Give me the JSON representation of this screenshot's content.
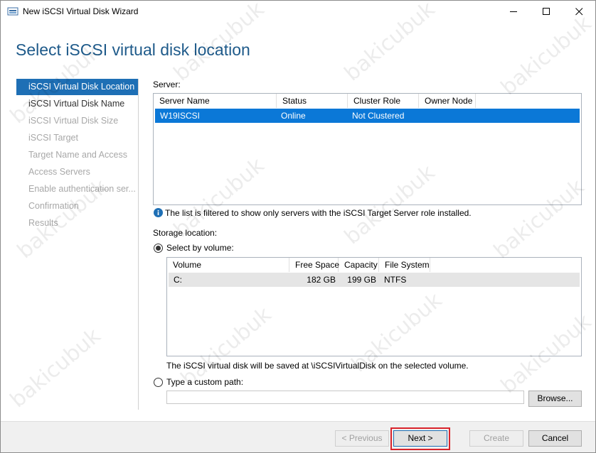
{
  "window": {
    "title": "New iSCSI Virtual Disk Wizard"
  },
  "page_title": "Select iSCSI virtual disk location",
  "nav": {
    "items": [
      {
        "label": "iSCSI Virtual Disk Location",
        "state": "active"
      },
      {
        "label": "iSCSI Virtual Disk Name",
        "state": "enabled"
      },
      {
        "label": "iSCSI Virtual Disk Size",
        "state": "disabled"
      },
      {
        "label": "iSCSI Target",
        "state": "disabled"
      },
      {
        "label": "Target Name and Access",
        "state": "disabled"
      },
      {
        "label": "Access Servers",
        "state": "disabled"
      },
      {
        "label": "Enable authentication ser...",
        "state": "disabled"
      },
      {
        "label": "Confirmation",
        "state": "disabled"
      },
      {
        "label": "Results",
        "state": "disabled"
      }
    ]
  },
  "server": {
    "label": "Server:",
    "columns": [
      "Server Name",
      "Status",
      "Cluster Role",
      "Owner Node"
    ],
    "rows": [
      {
        "server_name": "W19ISCSI",
        "status": "Online",
        "cluster_role": "Not Clustered",
        "owner_node": ""
      }
    ],
    "info_text": "The list is filtered to show only servers with the iSCSI Target Server role installed."
  },
  "storage": {
    "label": "Storage location:",
    "by_volume_label": "Select by volume:",
    "columns": [
      "Volume",
      "Free Space",
      "Capacity",
      "File System"
    ],
    "rows": [
      {
        "volume": "C:",
        "free_space": "182 GB",
        "capacity": "199 GB",
        "file_system": "NTFS"
      }
    ],
    "save_note": "The iSCSI virtual disk will be saved at \\iSCSIVirtualDisk on the selected volume.",
    "custom_path_label": "Type a custom path:",
    "custom_path_value": "",
    "browse_label": "Browse..."
  },
  "buttons": {
    "previous": "< Previous",
    "next": "Next >",
    "create": "Create",
    "cancel": "Cancel"
  },
  "watermark": "bakicubuk",
  "colors": {
    "accent": "#1e6fb5",
    "title": "#1e5a8a",
    "highlight_box": "#d9232b"
  }
}
